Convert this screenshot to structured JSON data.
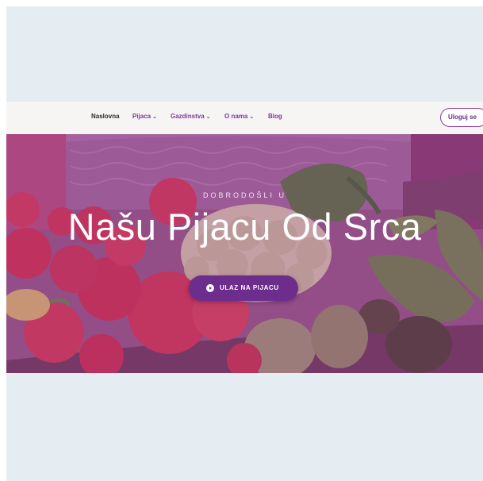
{
  "navbar": {
    "items": [
      {
        "label": "Naslovna",
        "has_dropdown": false
      },
      {
        "label": "Pijaca",
        "has_dropdown": true
      },
      {
        "label": "Gazdinstva",
        "has_dropdown": true
      },
      {
        "label": "O nama",
        "has_dropdown": true
      },
      {
        "label": "Blog",
        "has_dropdown": false
      }
    ],
    "chevron_glyph": "⌄",
    "login_label": "Uloguj se"
  },
  "hero": {
    "kicker": "DOBRODOŠLI U",
    "headline": "Našu Pijacu Od Srca",
    "cta_label": "ULAZ NA PIJACU",
    "cta_icon": "arrow-right-circle-icon",
    "background_image": "vegetable-basket-photo"
  },
  "colors": {
    "brand": "#6c2d8c",
    "overlay": "#873791",
    "nav_background": "#f7f5f3",
    "page_background": "#e5ecf2"
  }
}
